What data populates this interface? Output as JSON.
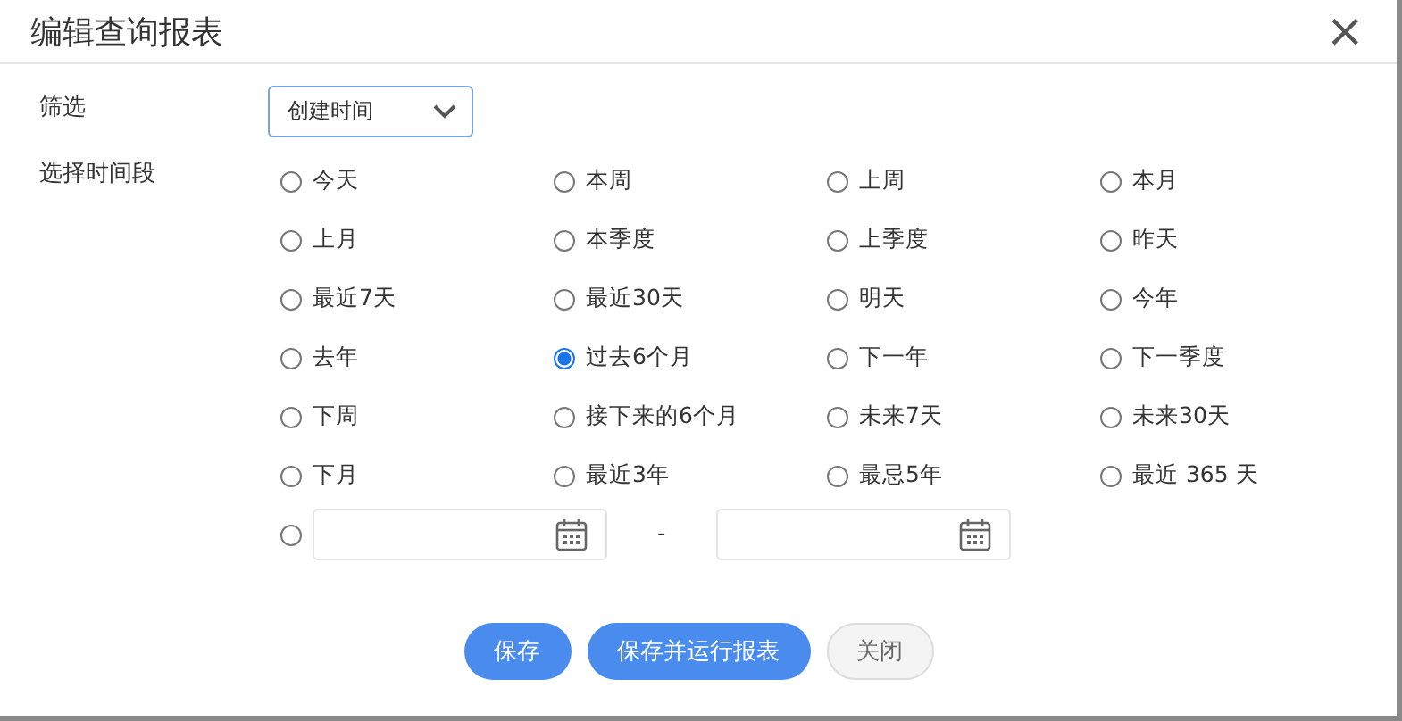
{
  "dialog": {
    "title": "编辑查询报表",
    "close_icon": "×"
  },
  "filter": {
    "label": "筛选",
    "value": "创建时间"
  },
  "period": {
    "label": "选择时间段",
    "options": [
      {
        "label": "今天",
        "selected": false
      },
      {
        "label": "本周",
        "selected": false
      },
      {
        "label": "上周",
        "selected": false
      },
      {
        "label": "本月",
        "selected": false
      },
      {
        "label": "上月",
        "selected": false
      },
      {
        "label": "本季度",
        "selected": false
      },
      {
        "label": "上季度",
        "selected": false
      },
      {
        "label": "昨天",
        "selected": false
      },
      {
        "label": "最近7天",
        "selected": false
      },
      {
        "label": "最近30天",
        "selected": false
      },
      {
        "label": "明天",
        "selected": false
      },
      {
        "label": "今年",
        "selected": false
      },
      {
        "label": "去年",
        "selected": false
      },
      {
        "label": "过去6个月",
        "selected": true
      },
      {
        "label": "下一年",
        "selected": false
      },
      {
        "label": "下一季度",
        "selected": false
      },
      {
        "label": "下周",
        "selected": false
      },
      {
        "label": "接下来的6个月",
        "selected": false
      },
      {
        "label": "未来7天",
        "selected": false
      },
      {
        "label": "未来30天",
        "selected": false
      },
      {
        "label": "下月",
        "selected": false
      },
      {
        "label": "最近3年",
        "selected": false
      },
      {
        "label": "最忌5年",
        "selected": false
      },
      {
        "label": "最近 365 天",
        "selected": false
      }
    ],
    "custom_range": {
      "selected": false,
      "separator": "-"
    }
  },
  "buttons": [
    {
      "label": "保存",
      "kind": "primary"
    },
    {
      "label": "保存并运行报表",
      "kind": "primary"
    },
    {
      "label": "关闭",
      "kind": "default"
    }
  ]
}
